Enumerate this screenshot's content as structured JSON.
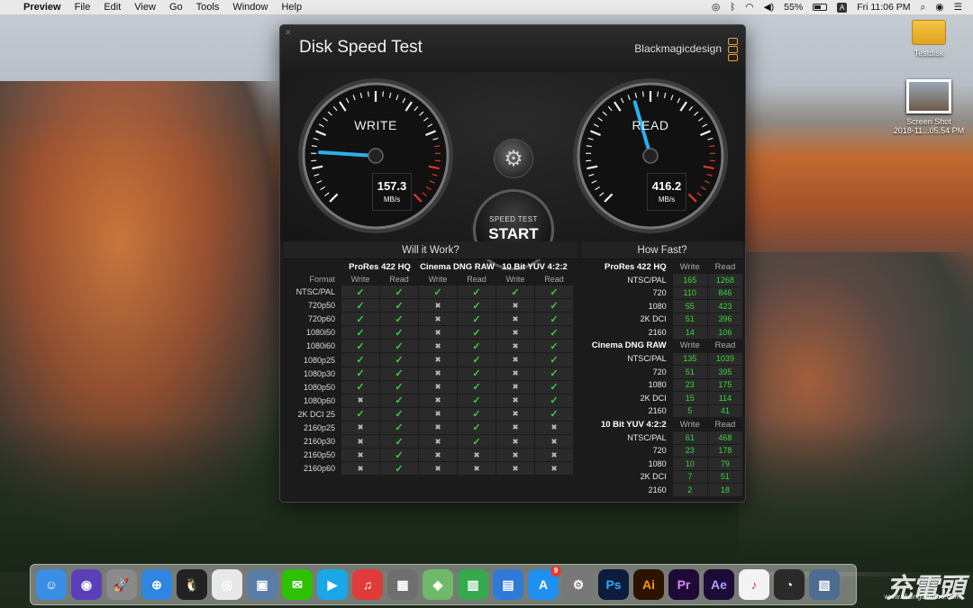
{
  "menubar": {
    "app": "Preview",
    "items": [
      "File",
      "Edit",
      "View",
      "Go",
      "Tools",
      "Window",
      "Help"
    ],
    "battery": "55%",
    "time": "Fri 11:06 PM"
  },
  "desktop": {
    "drive_label": "Testdisk",
    "screenshot_label_1": "Screen Shot",
    "screenshot_label_2": "2018-11...05.54 PM"
  },
  "window": {
    "title": "Disk Speed Test",
    "brand": "Blackmagicdesign",
    "write_label": "WRITE",
    "write_value": "157.3",
    "read_label": "READ",
    "read_value": "416.2",
    "unit": "MB/s",
    "start_line1": "SPEED TEST",
    "start_line2": "START",
    "will_it_work": "Will it Work?",
    "how_fast": "How Fast?",
    "format_label": "Format",
    "write_col": "Write",
    "read_col": "Read",
    "codecs": [
      "ProRes 422 HQ",
      "Cinema DNG RAW",
      "10 Bit YUV 4:2:2"
    ],
    "formats": [
      "NTSC/PAL",
      "720p50",
      "720p60",
      "1080i50",
      "1080i60",
      "1080p25",
      "1080p30",
      "1080p50",
      "1080p60",
      "2K DCI 25",
      "2160p25",
      "2160p30",
      "2160p50",
      "2160p60"
    ],
    "support": [
      [
        1,
        1,
        1,
        1,
        1,
        1
      ],
      [
        1,
        1,
        0,
        1,
        0,
        1
      ],
      [
        1,
        1,
        0,
        1,
        0,
        1
      ],
      [
        1,
        1,
        0,
        1,
        0,
        1
      ],
      [
        1,
        1,
        0,
        1,
        0,
        1
      ],
      [
        1,
        1,
        0,
        1,
        0,
        1
      ],
      [
        1,
        1,
        0,
        1,
        0,
        1
      ],
      [
        1,
        1,
        0,
        1,
        0,
        1
      ],
      [
        0,
        1,
        0,
        1,
        0,
        1
      ],
      [
        1,
        1,
        0,
        1,
        0,
        1
      ],
      [
        0,
        1,
        0,
        1,
        0,
        0
      ],
      [
        0,
        1,
        0,
        1,
        0,
        0
      ],
      [
        0,
        1,
        0,
        0,
        0,
        0
      ],
      [
        0,
        1,
        0,
        0,
        0,
        0
      ]
    ],
    "how_fast_groups": [
      {
        "name": "ProRes 422 HQ",
        "rows": [
          [
            "NTSC/PAL",
            "165",
            "1268"
          ],
          [
            "720",
            "110",
            "846"
          ],
          [
            "1080",
            "55",
            "423"
          ],
          [
            "2K DCI",
            "51",
            "396"
          ],
          [
            "2160",
            "14",
            "106"
          ]
        ]
      },
      {
        "name": "Cinema DNG RAW",
        "rows": [
          [
            "NTSC/PAL",
            "135",
            "1039"
          ],
          [
            "720",
            "51",
            "395"
          ],
          [
            "1080",
            "23",
            "175"
          ],
          [
            "2K DCI",
            "15",
            "114"
          ],
          [
            "2160",
            "5",
            "41"
          ]
        ]
      },
      {
        "name": "10 Bit YUV 4:2:2",
        "rows": [
          [
            "NTSC/PAL",
            "61",
            "468"
          ],
          [
            "720",
            "23",
            "178"
          ],
          [
            "1080",
            "10",
            "79"
          ],
          [
            "2K DCI",
            "7",
            "51"
          ],
          [
            "2160",
            "2",
            "18"
          ]
        ]
      }
    ],
    "write_gauge_fraction": 0.18,
    "read_gauge_fraction": 0.44
  },
  "dock": {
    "apps": [
      {
        "icon": "finder-icon",
        "color": "#3a8ee6",
        "glyph": "☺"
      },
      {
        "icon": "siri-icon",
        "color": "#5b3fb8",
        "glyph": "◉"
      },
      {
        "icon": "launchpad-icon",
        "color": "#8a8a8a",
        "glyph": "🚀"
      },
      {
        "icon": "safari-icon",
        "color": "#2f86e0",
        "glyph": "⊕"
      },
      {
        "icon": "qq-icon",
        "color": "#222222",
        "glyph": "🐧"
      },
      {
        "icon": "chrome-icon",
        "color": "#e8e8e8",
        "glyph": "◎"
      },
      {
        "icon": "preview-icon",
        "color": "#5a7da8",
        "glyph": "▣"
      },
      {
        "icon": "wechat-icon",
        "color": "#2dc100",
        "glyph": "✉"
      },
      {
        "icon": "video-icon",
        "color": "#1aa7e8",
        "glyph": "▶"
      },
      {
        "icon": "music-app-icon",
        "color": "#e03b3b",
        "glyph": "♫"
      },
      {
        "icon": "calculator-icon",
        "color": "#6e6e6e",
        "glyph": "▦"
      },
      {
        "icon": "maps-icon",
        "color": "#6fb96a",
        "glyph": "◈"
      },
      {
        "icon": "numbers-icon",
        "color": "#35a94c",
        "glyph": "▥"
      },
      {
        "icon": "keynote-icon",
        "color": "#2f79d8",
        "glyph": "▤"
      },
      {
        "icon": "app-store-icon",
        "color": "#1e90f2",
        "glyph": "A",
        "badge": "9"
      },
      {
        "icon": "system-preferences-icon",
        "color": "#777777",
        "glyph": "⚙"
      },
      {
        "icon": "photoshop-icon",
        "color": "#0d1c3a",
        "glyph": "Ps",
        "fg": "#31a8ff"
      },
      {
        "icon": "illustrator-icon",
        "color": "#2b1300",
        "glyph": "Ai",
        "fg": "#ff9a00"
      },
      {
        "icon": "premiere-icon",
        "color": "#1f0a35",
        "glyph": "Pr",
        "fg": "#d38cff"
      },
      {
        "icon": "after-effects-icon",
        "color": "#1c0b36",
        "glyph": "Ae",
        "fg": "#b79cff"
      },
      {
        "icon": "itunes-icon",
        "color": "#f3f3f3",
        "glyph": "♪",
        "fg": "#e0338f"
      },
      {
        "icon": "disk-speed-test-icon",
        "color": "#2a2a2a",
        "glyph": "◔"
      },
      {
        "icon": "photo-viewer-icon",
        "color": "#4c6c92",
        "glyph": "▧"
      }
    ]
  },
  "watermark": {
    "text": "充電頭",
    "url": "www.chongdiantou.com"
  }
}
